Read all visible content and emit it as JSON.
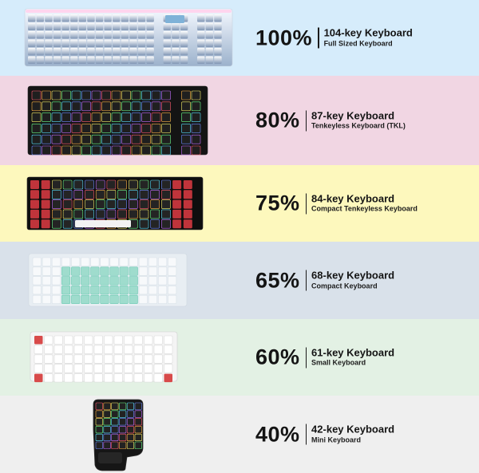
{
  "rows": [
    {
      "percent": "100%",
      "keys": "104-key Keyboard",
      "desc": "Full Sized Keyboard",
      "bg": "#d6ecfb"
    },
    {
      "percent": "80%",
      "keys": "87-key Keyboard",
      "desc": "Tenkeyless Keyboard (TKL)",
      "bg": "#f1d6e3"
    },
    {
      "percent": "75%",
      "keys": "84-key Keyboard",
      "desc": "Compact Tenkeyless Keyboard",
      "bg": "#fdf8bd"
    },
    {
      "percent": "65%",
      "keys": "68-key Keyboard",
      "desc": "Compact Keyboard",
      "bg": "#d9e1ea"
    },
    {
      "percent": "60%",
      "keys": "61-key Keyboard",
      "desc": "Small Keyboard",
      "bg": "#e3f1e4"
    },
    {
      "percent": "40%",
      "keys": "42-key Keyboard",
      "desc": "Mini Keyboard",
      "bg": "#efefef"
    }
  ]
}
